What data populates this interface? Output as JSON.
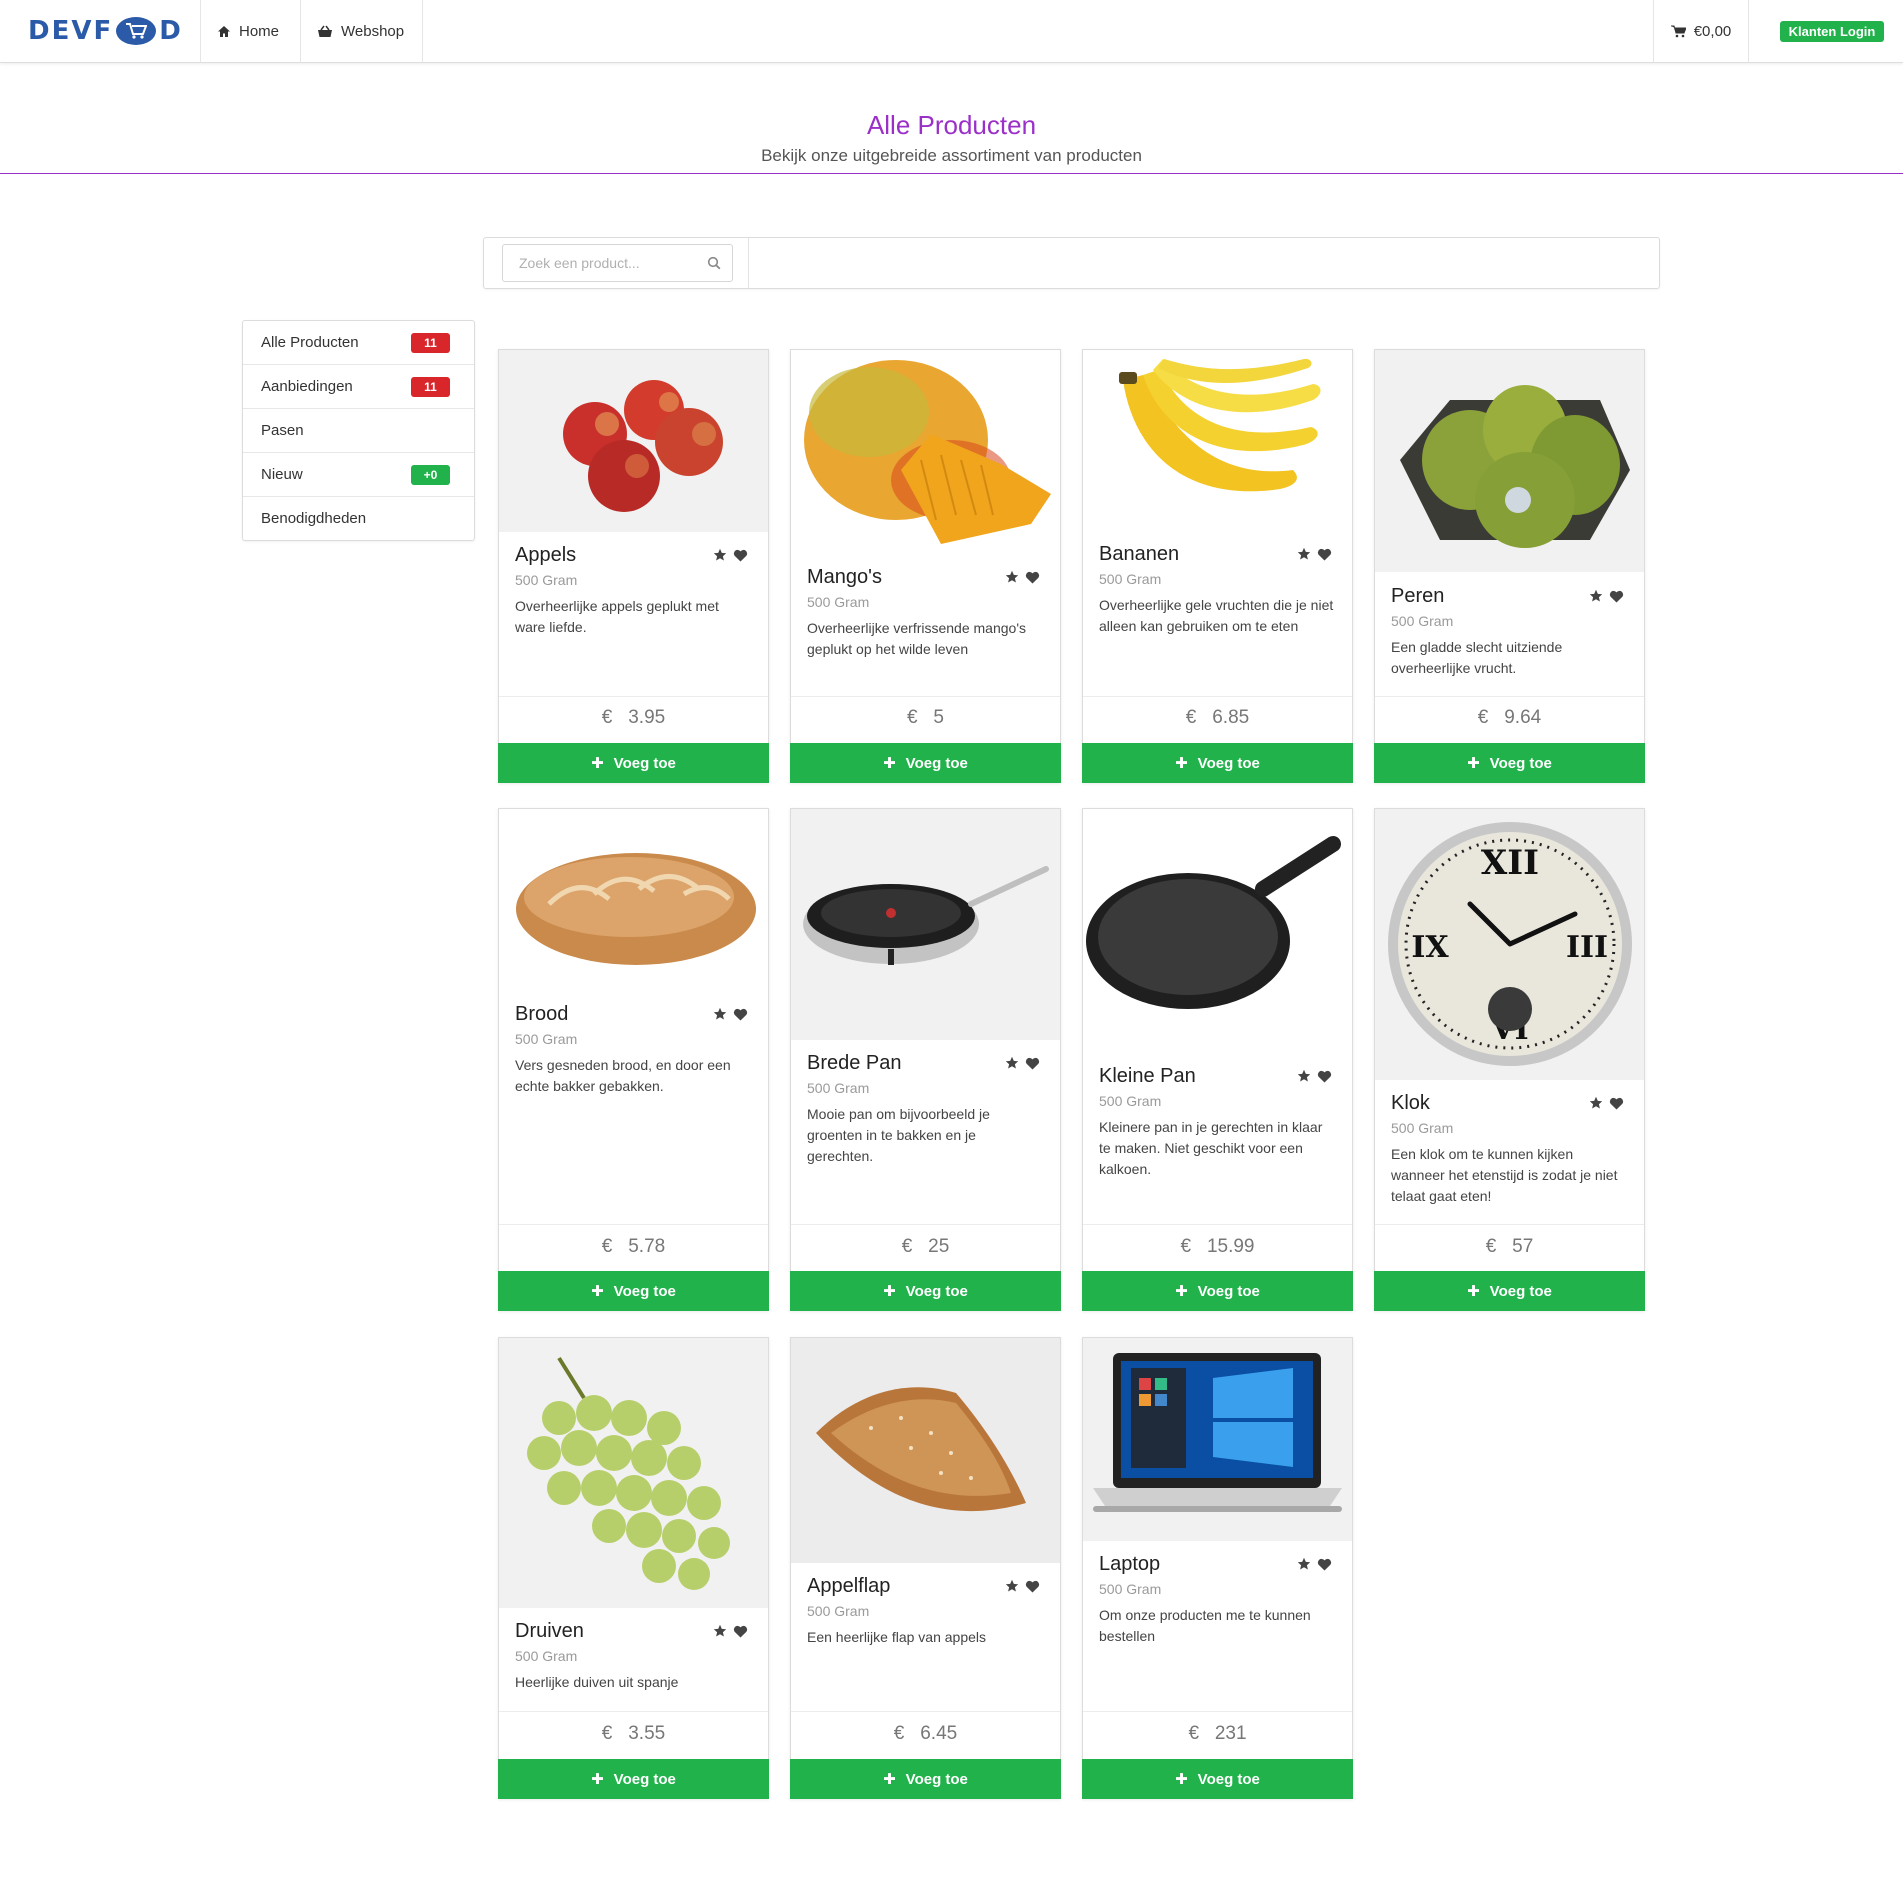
{
  "nav": {
    "logo_left": "DEVF",
    "logo_right": "D",
    "home": "Home",
    "webshop": "Webshop",
    "cart_total": "€0,00",
    "login": "Klanten Login"
  },
  "hero": {
    "title": "Alle Producten",
    "subtitle": "Bekijk onze uitgebreide assortiment van producten"
  },
  "search": {
    "placeholder": "Zoek een product..."
  },
  "sidebar": {
    "items": [
      {
        "label": "Alle Producten",
        "badge": "11",
        "badge_color": "#d9262b"
      },
      {
        "label": "Aanbiedingen",
        "badge": "11",
        "badge_color": "#d9262b"
      },
      {
        "label": "Pasen",
        "badge": null
      },
      {
        "label": "Nieuw",
        "badge": "+0",
        "badge_color": "#22b24c"
      },
      {
        "label": "Benodigdheden",
        "badge": null
      }
    ]
  },
  "products": [
    {
      "name": "Appels",
      "unit": "500 Gram",
      "desc": "Overheerlijke appels geplukt met ware liefde.",
      "price": "3.95"
    },
    {
      "name": "Mango's",
      "unit": "500 Gram",
      "desc": "Overheerlijke verfrissende mango's geplukt op het wilde leven",
      "price": "5"
    },
    {
      "name": "Bananen",
      "unit": "500 Gram",
      "desc": "Overheerlijke gele vruchten die je niet alleen kan gebruiken om te eten",
      "price": "6.85"
    },
    {
      "name": "Peren",
      "unit": "500 Gram",
      "desc": "Een gladde slecht uitziende overheerlijke vrucht.",
      "price": "9.64"
    },
    {
      "name": "Brood",
      "unit": "500 Gram",
      "desc": "Vers gesneden brood, en door een echte bakker gebakken.",
      "price": "5.78"
    },
    {
      "name": "Brede Pan",
      "unit": "500 Gram",
      "desc": "Mooie pan om bijvoorbeeld je groenten in te bakken en je gerechten.",
      "price": "25"
    },
    {
      "name": "Kleine Pan",
      "unit": "500 Gram",
      "desc": "Kleinere pan in je gerechten in klaar te maken. Niet geschikt voor een kalkoen.",
      "price": "15.99"
    },
    {
      "name": "Klok",
      "unit": "500 Gram",
      "desc": "Een klok om te kunnen kijken wanneer het etenstijd is zodat je niet telaat gaat eten!",
      "price": "57"
    },
    {
      "name": "Druiven",
      "unit": "500 Gram",
      "desc": "Heerlijke duiven uit spanje",
      "price": "3.55"
    },
    {
      "name": "Appelflap",
      "unit": "500 Gram",
      "desc": "Een heerlijke flap van appels",
      "price": "6.45"
    },
    {
      "name": "Laptop",
      "unit": "500 Gram",
      "desc": "Om onze producten me te kunnen bestellen",
      "price": "231"
    }
  ],
  "currency": "€",
  "add_label": "Voeg toe",
  "colors": {
    "accent": "#9b30c9",
    "green": "#22b24c",
    "red": "#d9262b",
    "brand": "#2b5aa8"
  }
}
